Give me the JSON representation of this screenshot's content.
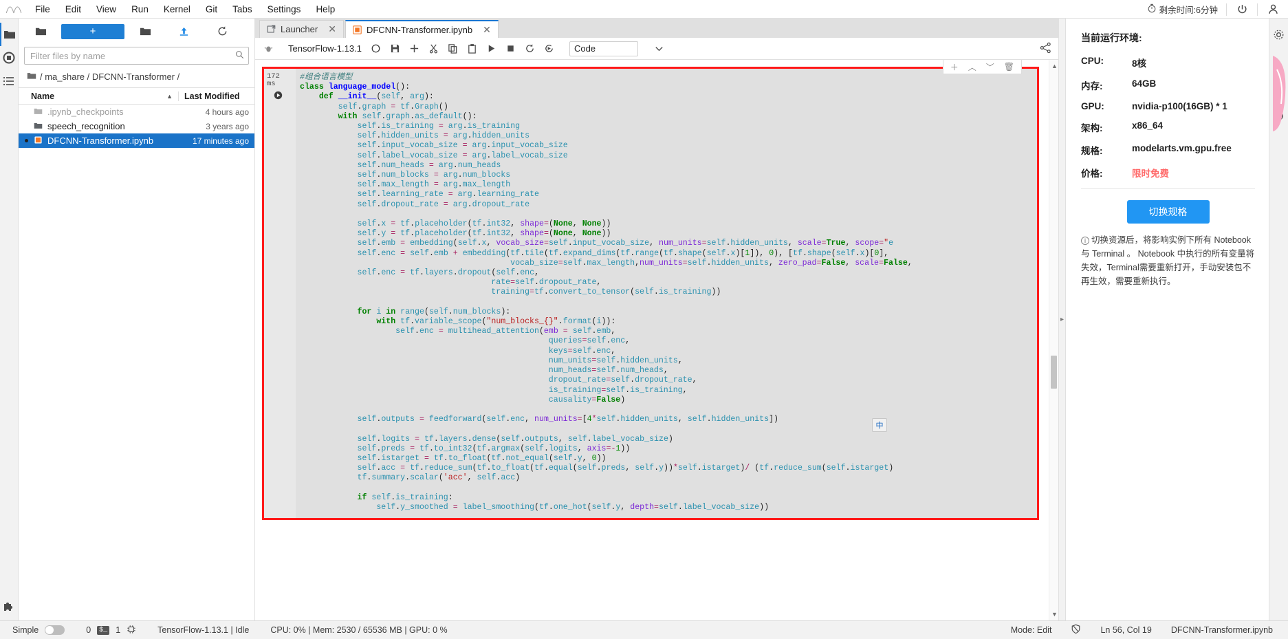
{
  "menubar": {
    "logo": "jupyter-logo",
    "items": [
      "File",
      "Edit",
      "View",
      "Run",
      "Kernel",
      "Git",
      "Tabs",
      "Settings",
      "Help"
    ],
    "timer_text": "剩余时间:6分钟",
    "power_icon": "power-icon",
    "user_icon": "user-icon"
  },
  "left_rail": {
    "items": [
      {
        "name": "folder-icon",
        "label": "Files"
      },
      {
        "name": "running-icon",
        "label": "Running Terminals and Kernels"
      },
      {
        "name": "commands-icon",
        "label": "Commands"
      },
      {
        "name": "toc-icon",
        "label": "Table of Contents"
      },
      {
        "name": "extension-icon",
        "label": "Extension Manager"
      }
    ]
  },
  "filebrowser": {
    "new_button": "+",
    "toolbar_icons": [
      "new-folder-icon",
      "upload-icon",
      "refresh-icon"
    ],
    "filter_placeholder": "Filter files by name",
    "filter_value": "",
    "breadcrumb": "/ ma_share / DFCNN-Transformer /",
    "columns": [
      "Name",
      "Last Modified"
    ],
    "sort_indicator": "▲",
    "rows": [
      {
        "name": ".ipynb_checkpoints",
        "modified": "4 hours ago",
        "type": "folder",
        "dim": true,
        "selected": false
      },
      {
        "name": "speech_recognition",
        "modified": "3 years ago",
        "type": "folder",
        "dim": false,
        "selected": false
      },
      {
        "name": "DFCNN-Transformer.ipynb",
        "modified": "17 minutes ago",
        "type": "notebook",
        "dim": false,
        "selected": true
      }
    ]
  },
  "tabs": [
    {
      "label": "Launcher",
      "icon": "launcher-icon",
      "active": false,
      "closable": true
    },
    {
      "label": "DFCNN-Transformer.ipynb",
      "icon": "notebook-icon",
      "active": true,
      "closable": true
    }
  ],
  "notebook_toolbar": {
    "kernel_label": "TensorFlow-1.13.1",
    "icons": [
      "bug-icon",
      "kernel-busy-icon",
      "save-icon",
      "add-cell-icon",
      "cut-icon",
      "copy-icon",
      "paste-icon",
      "run-icon",
      "stop-icon",
      "restart-icon",
      "restart-run-all-icon"
    ],
    "celltype_value": "Code",
    "celltype_caret": "⌄",
    "share_icon": "share-icon"
  },
  "cell": {
    "exec_time": "172",
    "exec_unit": "ms",
    "run_icon": "play-circle-icon",
    "tools": [
      "add-icon",
      "move-up-icon",
      "move-down-icon",
      "delete-icon"
    ],
    "ime_badge": "中",
    "code_lines": [
      "#组合语言模型",
      "class language_model():",
      "    def __init__(self, arg):",
      "        self.graph = tf.Graph()",
      "        with self.graph.as_default():",
      "            self.is_training = arg.is_training",
      "            self.hidden_units = arg.hidden_units",
      "            self.input_vocab_size = arg.input_vocab_size",
      "            self.label_vocab_size = arg.label_vocab_size",
      "            self.num_heads = arg.num_heads",
      "            self.num_blocks = arg.num_blocks",
      "            self.max_length = arg.max_length",
      "            self.learning_rate = arg.learning_rate",
      "            self.dropout_rate = arg.dropout_rate",
      "",
      "            self.x = tf.placeholder(tf.int32, shape=(None, None))",
      "            self.y = tf.placeholder(tf.int32, shape=(None, None))",
      "            self.emb = embedding(self.x, vocab_size=self.input_vocab_size, num_units=self.hidden_units, scale=True, scope=\"e",
      "            self.enc = self.emb + embedding(tf.tile(tf.expand_dims(tf.range(tf.shape(self.x)[1]), 0), [tf.shape(self.x)[0],",
      "                                            vocab_size=self.max_length,num_units=self.hidden_units, zero_pad=False, scale=False,",
      "            self.enc = tf.layers.dropout(self.enc,",
      "                                        rate=self.dropout_rate,",
      "                                        training=tf.convert_to_tensor(self.is_training))",
      "",
      "            for i in range(self.num_blocks):",
      "                with tf.variable_scope(\"num_blocks_{}\".format(i)):",
      "                    self.enc = multihead_attention(emb = self.emb,",
      "                                                    queries=self.enc,",
      "                                                    keys=self.enc,",
      "                                                    num_units=self.hidden_units,",
      "                                                    num_heads=self.num_heads,",
      "                                                    dropout_rate=self.dropout_rate,",
      "                                                    is_training=self.is_training,",
      "                                                    causality=False)",
      "",
      "            self.outputs = feedforward(self.enc, num_units=[4*self.hidden_units, self.hidden_units])",
      "",
      "            self.logits = tf.layers.dense(self.outputs, self.label_vocab_size)",
      "            self.preds = tf.to_int32(tf.argmax(self.logits, axis=-1))",
      "            self.istarget = tf.to_float(tf.not_equal(self.y, 0))",
      "            self.acc = tf.reduce_sum(tf.to_float(tf.equal(self.preds, self.y))*self.istarget)/ (tf.reduce_sum(self.istarget)",
      "            tf.summary.scalar('acc', self.acc)",
      "",
      "            if self.is_training:",
      "                self.y_smoothed = label_smoothing(tf.one_hot(self.y, depth=self.label_vocab_size))"
    ]
  },
  "right_panel": {
    "title": "当前运行环境:",
    "specs": [
      {
        "key": "CPU:",
        "value": "8核",
        "highlight": false
      },
      {
        "key": "内存:",
        "value": "64GB",
        "highlight": false
      },
      {
        "key": "GPU:",
        "value": "nvidia-p100(16GB) * 1",
        "highlight": false
      },
      {
        "key": "架构:",
        "value": "x86_64",
        "highlight": false
      },
      {
        "key": "规格:",
        "value": "modelarts.vm.gpu.free",
        "highlight": false
      },
      {
        "key": "价格:",
        "value": "限时免费",
        "highlight": true
      }
    ],
    "switch_button": "切换规格",
    "note": "切换资源后，将影响实例下所有 Notebook 与 Terminal 。 Notebook 中执行的所有变量将失效，Terminal需要重新打开，手动安装包不再生效，需要重新执行。"
  },
  "right_rail": {
    "items": [
      "settings-gear-icon",
      "property-inspector-icon",
      "layers-icon"
    ]
  },
  "statusbar": {
    "simple_label": "Simple",
    "toggle_state": "off",
    "terminal_count": "0",
    "terminal_icon": "terminal-icon",
    "kernel_count": "1",
    "kernel_icon": "kernel-chip-icon",
    "kernel_status": "TensorFlow-1.13.1 | Idle",
    "resources": "CPU: 0% | Mem: 2530 / 65536 MB | GPU: 0 %",
    "mode": "Mode: Edit",
    "shield_icon": "no-trust-icon",
    "cursor": "Ln 56, Col 19",
    "filename": "DFCNN-Transformer.ipynb"
  },
  "colors": {
    "accent": "#1e7fd4",
    "cell_highlight": "#ff1a1a",
    "free_price": "#ff6a6a",
    "switch_button": "#2196f3"
  }
}
